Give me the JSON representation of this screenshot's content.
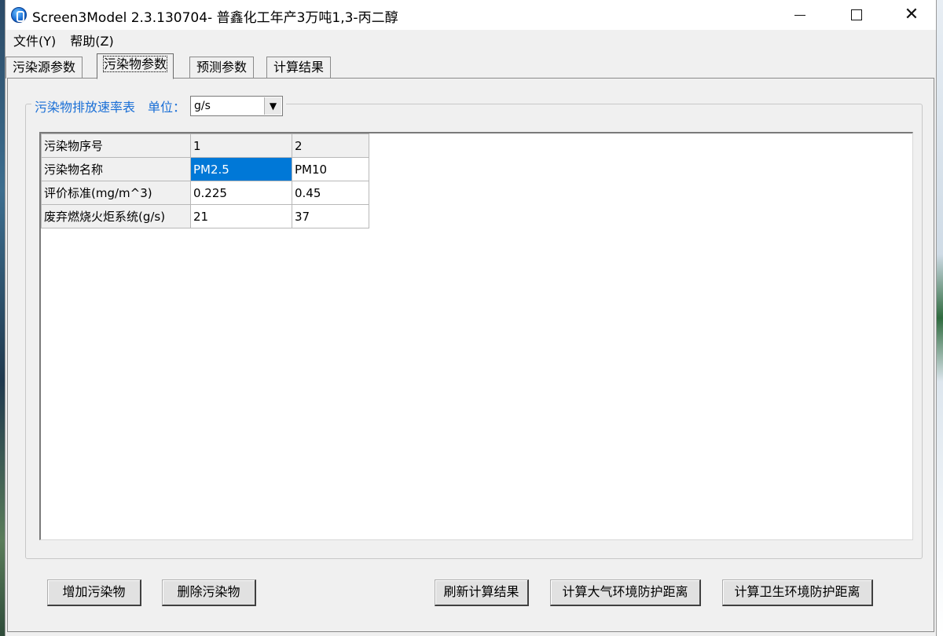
{
  "window": {
    "title": "Screen3Model 2.3.130704- 普鑫化工年产3万吨1,3-丙二醇"
  },
  "menu": {
    "items": [
      {
        "label": "文件(Y)"
      },
      {
        "label": "帮助(Z)"
      }
    ]
  },
  "tabs": [
    {
      "label": "污染源参数",
      "active": false
    },
    {
      "label": "污染物参数",
      "active": true
    },
    {
      "label": "预测参数",
      "active": false
    },
    {
      "label": "计算结果",
      "active": false
    }
  ],
  "group": {
    "caption": "污染物排放速率表",
    "unit_label": "单位：",
    "unit_value": "g/s"
  },
  "grid": {
    "rows": [
      {
        "header": "污染物序号",
        "cells": [
          "1",
          "2"
        ],
        "is_header_row": true
      },
      {
        "header": "污染物名称",
        "cells": [
          "PM2.5",
          "PM10"
        ]
      },
      {
        "header": "评价标准(mg/m^3)",
        "cells": [
          "0.225",
          "0.45"
        ]
      },
      {
        "header": "废弃燃烧火炬系统(g/s)",
        "cells": [
          "21",
          "37"
        ]
      }
    ],
    "selected_cell": {
      "row": 1,
      "col": 0
    }
  },
  "buttons": {
    "add": "增加污染物",
    "delete": "删除污染物",
    "refresh": "刷新计算结果",
    "atmospheric": "计算大气环境防护距离",
    "health": "计算卫生环境防护距离"
  },
  "colors": {
    "accent_text": "#1a6fd6",
    "selection": "#0078d7"
  }
}
